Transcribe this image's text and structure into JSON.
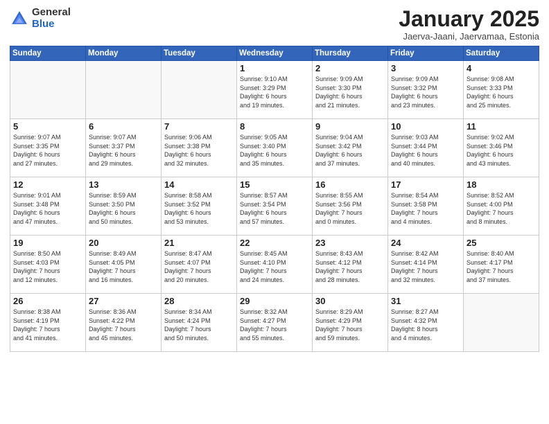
{
  "logo": {
    "general": "General",
    "blue": "Blue"
  },
  "title": "January 2025",
  "location": "Jaerva-Jaani, Jaervamaa, Estonia",
  "weekdays": [
    "Sunday",
    "Monday",
    "Tuesday",
    "Wednesday",
    "Thursday",
    "Friday",
    "Saturday"
  ],
  "weeks": [
    [
      {
        "day": "",
        "info": ""
      },
      {
        "day": "",
        "info": ""
      },
      {
        "day": "",
        "info": ""
      },
      {
        "day": "1",
        "info": "Sunrise: 9:10 AM\nSunset: 3:29 PM\nDaylight: 6 hours\nand 19 minutes."
      },
      {
        "day": "2",
        "info": "Sunrise: 9:09 AM\nSunset: 3:30 PM\nDaylight: 6 hours\nand 21 minutes."
      },
      {
        "day": "3",
        "info": "Sunrise: 9:09 AM\nSunset: 3:32 PM\nDaylight: 6 hours\nand 23 minutes."
      },
      {
        "day": "4",
        "info": "Sunrise: 9:08 AM\nSunset: 3:33 PM\nDaylight: 6 hours\nand 25 minutes."
      }
    ],
    [
      {
        "day": "5",
        "info": "Sunrise: 9:07 AM\nSunset: 3:35 PM\nDaylight: 6 hours\nand 27 minutes."
      },
      {
        "day": "6",
        "info": "Sunrise: 9:07 AM\nSunset: 3:37 PM\nDaylight: 6 hours\nand 29 minutes."
      },
      {
        "day": "7",
        "info": "Sunrise: 9:06 AM\nSunset: 3:38 PM\nDaylight: 6 hours\nand 32 minutes."
      },
      {
        "day": "8",
        "info": "Sunrise: 9:05 AM\nSunset: 3:40 PM\nDaylight: 6 hours\nand 35 minutes."
      },
      {
        "day": "9",
        "info": "Sunrise: 9:04 AM\nSunset: 3:42 PM\nDaylight: 6 hours\nand 37 minutes."
      },
      {
        "day": "10",
        "info": "Sunrise: 9:03 AM\nSunset: 3:44 PM\nDaylight: 6 hours\nand 40 minutes."
      },
      {
        "day": "11",
        "info": "Sunrise: 9:02 AM\nSunset: 3:46 PM\nDaylight: 6 hours\nand 43 minutes."
      }
    ],
    [
      {
        "day": "12",
        "info": "Sunrise: 9:01 AM\nSunset: 3:48 PM\nDaylight: 6 hours\nand 47 minutes."
      },
      {
        "day": "13",
        "info": "Sunrise: 8:59 AM\nSunset: 3:50 PM\nDaylight: 6 hours\nand 50 minutes."
      },
      {
        "day": "14",
        "info": "Sunrise: 8:58 AM\nSunset: 3:52 PM\nDaylight: 6 hours\nand 53 minutes."
      },
      {
        "day": "15",
        "info": "Sunrise: 8:57 AM\nSunset: 3:54 PM\nDaylight: 6 hours\nand 57 minutes."
      },
      {
        "day": "16",
        "info": "Sunrise: 8:55 AM\nSunset: 3:56 PM\nDaylight: 7 hours\nand 0 minutes."
      },
      {
        "day": "17",
        "info": "Sunrise: 8:54 AM\nSunset: 3:58 PM\nDaylight: 7 hours\nand 4 minutes."
      },
      {
        "day": "18",
        "info": "Sunrise: 8:52 AM\nSunset: 4:00 PM\nDaylight: 7 hours\nand 8 minutes."
      }
    ],
    [
      {
        "day": "19",
        "info": "Sunrise: 8:50 AM\nSunset: 4:03 PM\nDaylight: 7 hours\nand 12 minutes."
      },
      {
        "day": "20",
        "info": "Sunrise: 8:49 AM\nSunset: 4:05 PM\nDaylight: 7 hours\nand 16 minutes."
      },
      {
        "day": "21",
        "info": "Sunrise: 8:47 AM\nSunset: 4:07 PM\nDaylight: 7 hours\nand 20 minutes."
      },
      {
        "day": "22",
        "info": "Sunrise: 8:45 AM\nSunset: 4:10 PM\nDaylight: 7 hours\nand 24 minutes."
      },
      {
        "day": "23",
        "info": "Sunrise: 8:43 AM\nSunset: 4:12 PM\nDaylight: 7 hours\nand 28 minutes."
      },
      {
        "day": "24",
        "info": "Sunrise: 8:42 AM\nSunset: 4:14 PM\nDaylight: 7 hours\nand 32 minutes."
      },
      {
        "day": "25",
        "info": "Sunrise: 8:40 AM\nSunset: 4:17 PM\nDaylight: 7 hours\nand 37 minutes."
      }
    ],
    [
      {
        "day": "26",
        "info": "Sunrise: 8:38 AM\nSunset: 4:19 PM\nDaylight: 7 hours\nand 41 minutes."
      },
      {
        "day": "27",
        "info": "Sunrise: 8:36 AM\nSunset: 4:22 PM\nDaylight: 7 hours\nand 45 minutes."
      },
      {
        "day": "28",
        "info": "Sunrise: 8:34 AM\nSunset: 4:24 PM\nDaylight: 7 hours\nand 50 minutes."
      },
      {
        "day": "29",
        "info": "Sunrise: 8:32 AM\nSunset: 4:27 PM\nDaylight: 7 hours\nand 55 minutes."
      },
      {
        "day": "30",
        "info": "Sunrise: 8:29 AM\nSunset: 4:29 PM\nDaylight: 7 hours\nand 59 minutes."
      },
      {
        "day": "31",
        "info": "Sunrise: 8:27 AM\nSunset: 4:32 PM\nDaylight: 8 hours\nand 4 minutes."
      },
      {
        "day": "",
        "info": ""
      }
    ]
  ]
}
